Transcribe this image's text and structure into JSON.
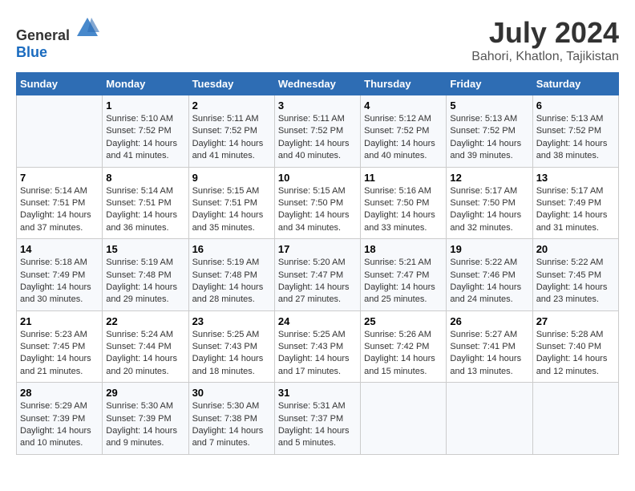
{
  "header": {
    "logo_general": "General",
    "logo_blue": "Blue",
    "title": "July 2024",
    "subtitle": "Bahori, Khatlon, Tajikistan"
  },
  "calendar": {
    "days_of_week": [
      "Sunday",
      "Monday",
      "Tuesday",
      "Wednesday",
      "Thursday",
      "Friday",
      "Saturday"
    ],
    "weeks": [
      [
        {
          "day": "",
          "details": ""
        },
        {
          "day": "1",
          "details": "Sunrise: 5:10 AM\nSunset: 7:52 PM\nDaylight: 14 hours\nand 41 minutes."
        },
        {
          "day": "2",
          "details": "Sunrise: 5:11 AM\nSunset: 7:52 PM\nDaylight: 14 hours\nand 41 minutes."
        },
        {
          "day": "3",
          "details": "Sunrise: 5:11 AM\nSunset: 7:52 PM\nDaylight: 14 hours\nand 40 minutes."
        },
        {
          "day": "4",
          "details": "Sunrise: 5:12 AM\nSunset: 7:52 PM\nDaylight: 14 hours\nand 40 minutes."
        },
        {
          "day": "5",
          "details": "Sunrise: 5:13 AM\nSunset: 7:52 PM\nDaylight: 14 hours\nand 39 minutes."
        },
        {
          "day": "6",
          "details": "Sunrise: 5:13 AM\nSunset: 7:52 PM\nDaylight: 14 hours\nand 38 minutes."
        }
      ],
      [
        {
          "day": "7",
          "details": "Sunrise: 5:14 AM\nSunset: 7:51 PM\nDaylight: 14 hours\nand 37 minutes."
        },
        {
          "day": "8",
          "details": "Sunrise: 5:14 AM\nSunset: 7:51 PM\nDaylight: 14 hours\nand 36 minutes."
        },
        {
          "day": "9",
          "details": "Sunrise: 5:15 AM\nSunset: 7:51 PM\nDaylight: 14 hours\nand 35 minutes."
        },
        {
          "day": "10",
          "details": "Sunrise: 5:15 AM\nSunset: 7:50 PM\nDaylight: 14 hours\nand 34 minutes."
        },
        {
          "day": "11",
          "details": "Sunrise: 5:16 AM\nSunset: 7:50 PM\nDaylight: 14 hours\nand 33 minutes."
        },
        {
          "day": "12",
          "details": "Sunrise: 5:17 AM\nSunset: 7:50 PM\nDaylight: 14 hours\nand 32 minutes."
        },
        {
          "day": "13",
          "details": "Sunrise: 5:17 AM\nSunset: 7:49 PM\nDaylight: 14 hours\nand 31 minutes."
        }
      ],
      [
        {
          "day": "14",
          "details": "Sunrise: 5:18 AM\nSunset: 7:49 PM\nDaylight: 14 hours\nand 30 minutes."
        },
        {
          "day": "15",
          "details": "Sunrise: 5:19 AM\nSunset: 7:48 PM\nDaylight: 14 hours\nand 29 minutes."
        },
        {
          "day": "16",
          "details": "Sunrise: 5:19 AM\nSunset: 7:48 PM\nDaylight: 14 hours\nand 28 minutes."
        },
        {
          "day": "17",
          "details": "Sunrise: 5:20 AM\nSunset: 7:47 PM\nDaylight: 14 hours\nand 27 minutes."
        },
        {
          "day": "18",
          "details": "Sunrise: 5:21 AM\nSunset: 7:47 PM\nDaylight: 14 hours\nand 25 minutes."
        },
        {
          "day": "19",
          "details": "Sunrise: 5:22 AM\nSunset: 7:46 PM\nDaylight: 14 hours\nand 24 minutes."
        },
        {
          "day": "20",
          "details": "Sunrise: 5:22 AM\nSunset: 7:45 PM\nDaylight: 14 hours\nand 23 minutes."
        }
      ],
      [
        {
          "day": "21",
          "details": "Sunrise: 5:23 AM\nSunset: 7:45 PM\nDaylight: 14 hours\nand 21 minutes."
        },
        {
          "day": "22",
          "details": "Sunrise: 5:24 AM\nSunset: 7:44 PM\nDaylight: 14 hours\nand 20 minutes."
        },
        {
          "day": "23",
          "details": "Sunrise: 5:25 AM\nSunset: 7:43 PM\nDaylight: 14 hours\nand 18 minutes."
        },
        {
          "day": "24",
          "details": "Sunrise: 5:25 AM\nSunset: 7:43 PM\nDaylight: 14 hours\nand 17 minutes."
        },
        {
          "day": "25",
          "details": "Sunrise: 5:26 AM\nSunset: 7:42 PM\nDaylight: 14 hours\nand 15 minutes."
        },
        {
          "day": "26",
          "details": "Sunrise: 5:27 AM\nSunset: 7:41 PM\nDaylight: 14 hours\nand 13 minutes."
        },
        {
          "day": "27",
          "details": "Sunrise: 5:28 AM\nSunset: 7:40 PM\nDaylight: 14 hours\nand 12 minutes."
        }
      ],
      [
        {
          "day": "28",
          "details": "Sunrise: 5:29 AM\nSunset: 7:39 PM\nDaylight: 14 hours\nand 10 minutes."
        },
        {
          "day": "29",
          "details": "Sunrise: 5:30 AM\nSunset: 7:39 PM\nDaylight: 14 hours\nand 9 minutes."
        },
        {
          "day": "30",
          "details": "Sunrise: 5:30 AM\nSunset: 7:38 PM\nDaylight: 14 hours\nand 7 minutes."
        },
        {
          "day": "31",
          "details": "Sunrise: 5:31 AM\nSunset: 7:37 PM\nDaylight: 14 hours\nand 5 minutes."
        },
        {
          "day": "",
          "details": ""
        },
        {
          "day": "",
          "details": ""
        },
        {
          "day": "",
          "details": ""
        }
      ]
    ]
  }
}
